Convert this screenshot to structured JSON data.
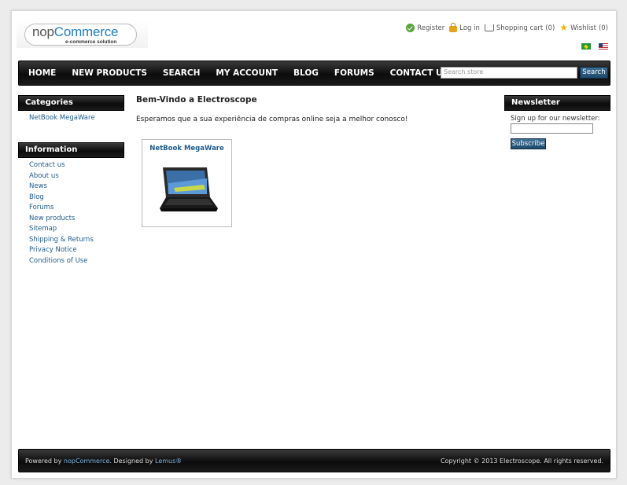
{
  "logo": {
    "prefix": "nop",
    "brand": "Commerce",
    "tagline": "e-commerce solution"
  },
  "header_links": [
    {
      "label": "Register",
      "icon": "check-icon"
    },
    {
      "label": "Log in",
      "icon": "lock-icon"
    },
    {
      "label": "Shopping cart",
      "count": "(0)",
      "icon": "cart-icon"
    },
    {
      "label": "Wishlist",
      "count": "(0)",
      "icon": "star-icon"
    }
  ],
  "flags": [
    "brazil-flag-icon",
    "us-flag-icon"
  ],
  "nav": {
    "items": [
      "HOME",
      "NEW PRODUCTS",
      "SEARCH",
      "MY ACCOUNT",
      "BLOG",
      "FORUMS",
      "CONTACT US"
    ]
  },
  "search": {
    "placeholder": "Search store",
    "button": "Search"
  },
  "categories": {
    "title": "Categories",
    "items": [
      "NetBook MegaWare"
    ]
  },
  "information": {
    "title": "Information",
    "items": [
      "Contact us",
      "About us",
      "News",
      "Blog",
      "Forums",
      "New products",
      "Sitemap",
      "Shipping & Returns",
      "Privacy Notice",
      "Conditions of Use"
    ]
  },
  "main": {
    "title": "Bem-Vindo a Electroscope",
    "text": "Esperamos que a sua experiência de compras online seja a melhor conosco!",
    "product": {
      "name": "NetBook MegaWare"
    }
  },
  "newsletter": {
    "title": "Newsletter",
    "label": "Sign up for our newsletter:",
    "button": "Subscribe"
  },
  "footer": {
    "powered_prefix": "Powered by ",
    "powered_link": "nopCommerce",
    "designed_prefix": ". Designed by ",
    "designed_link": "Lemus®",
    "copyright": "Copyright © 2013 Electroscope. All rights reserved."
  }
}
